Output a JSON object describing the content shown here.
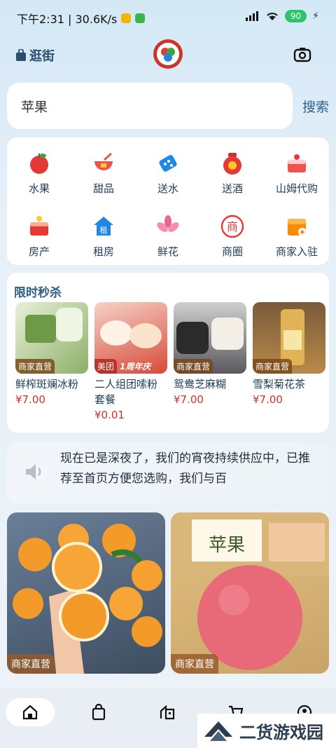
{
  "status_bar": {
    "time_speed": "下午2:31 | 30.6K/s",
    "battery": "90"
  },
  "header": {
    "shop_label": "逛街",
    "icons": {
      "bag": "shopping-bag-icon",
      "logo": "app-logo",
      "camera": "camera-icon"
    }
  },
  "search": {
    "value": "苹果",
    "button": "搜索"
  },
  "categories": [
    {
      "label": "水果",
      "icon": "apple-icon"
    },
    {
      "label": "甜品",
      "icon": "dessert-bowl-icon"
    },
    {
      "label": "送水",
      "icon": "water-drop-icon"
    },
    {
      "label": "送酒",
      "icon": "liquor-jar-icon"
    },
    {
      "label": "山姆代购",
      "icon": "cake-icon"
    },
    {
      "label": "房产",
      "icon": "house-cake-icon"
    },
    {
      "label": "租房",
      "icon": "rent-house-icon"
    },
    {
      "label": "鲜花",
      "icon": "lily-flower-icon"
    },
    {
      "label": "商圈",
      "icon": "business-circle-icon"
    },
    {
      "label": "商家入驻",
      "icon": "store-join-icon"
    }
  ],
  "flash_sale": {
    "title": "限时秒杀",
    "items": [
      {
        "tag": "商家直营",
        "name": "鲜榨斑斓冰粉",
        "price": "¥7.00",
        "color": "#8db06a"
      },
      {
        "tag": "美团",
        "badge": "1周年庆",
        "name": "二人组团嗦粉套餐",
        "price": "¥0.01",
        "color": "#d84a3a"
      },
      {
        "tag": "商家直营",
        "name": "鸳鸯芝麻糊",
        "price": "¥7.00",
        "color": "#5a5a5e"
      },
      {
        "tag": "商家直营",
        "name": "雪梨菊花茶",
        "price": "¥7.00",
        "color": "#b98a4a"
      }
    ]
  },
  "notice": {
    "text": "现在已是深夜了，我们的宵夜持续供应中，已推荐至首页方便您选购，我们与百"
  },
  "products": [
    {
      "tag": "商家直营",
      "color": "#f29a2a"
    },
    {
      "tag": "商家直营",
      "color": "#e86a78",
      "label": "苹果"
    }
  ],
  "tabs": [
    {
      "name": "home",
      "icon": "home-icon"
    },
    {
      "name": "shop",
      "icon": "shopping-bag-icon"
    },
    {
      "name": "building",
      "icon": "building-icon"
    },
    {
      "name": "cart",
      "icon": "cart-icon"
    },
    {
      "name": "profile",
      "icon": "profile-icon"
    }
  ],
  "watermark": {
    "text": "二货游戏园"
  }
}
